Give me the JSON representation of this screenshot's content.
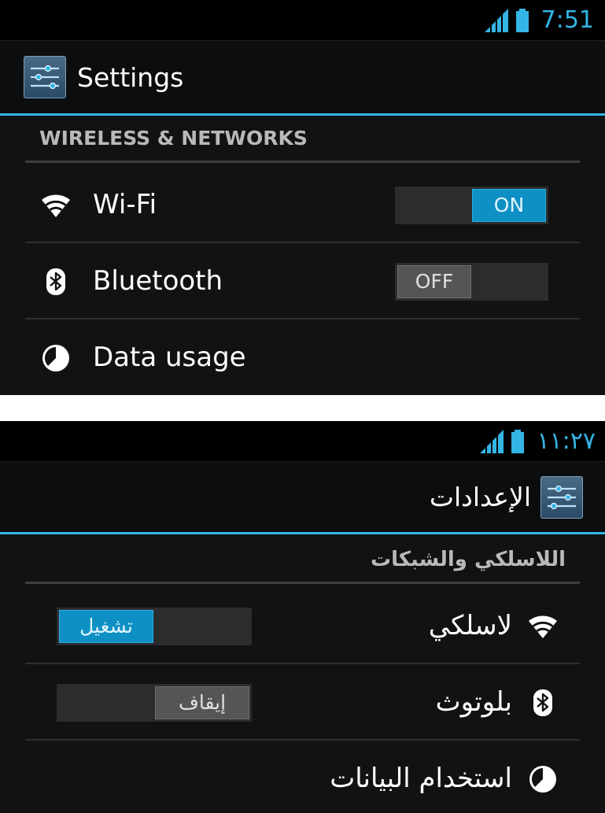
{
  "colors": {
    "accent": "#33b5e5",
    "background": "#111213",
    "toggle_on": "#0e90c4",
    "toggle_off": "#545557"
  },
  "screens": [
    {
      "lang": "en",
      "status": {
        "time": "7:51"
      },
      "title": "Settings",
      "section": "WIRELESS & NETWORKS",
      "items": [
        {
          "label": "Wi-Fi",
          "icon": "wifi-icon",
          "toggle": "ON"
        },
        {
          "label": "Bluetooth",
          "icon": "bluetooth-icon",
          "toggle": "OFF"
        },
        {
          "label": "Data usage",
          "icon": "data-usage-icon"
        }
      ]
    },
    {
      "lang": "ar",
      "status": {
        "time": "١١:٢٧"
      },
      "title": "الإعدادات",
      "section": "اللاسلكي والشبكات",
      "items": [
        {
          "label": "لاسلكي",
          "icon": "wifi-icon",
          "toggle": "تشغيل"
        },
        {
          "label": "بلوتوث",
          "icon": "bluetooth-icon",
          "toggle": "إيقاف"
        },
        {
          "label": "استخدام البيانات",
          "icon": "data-usage-icon"
        }
      ]
    }
  ]
}
